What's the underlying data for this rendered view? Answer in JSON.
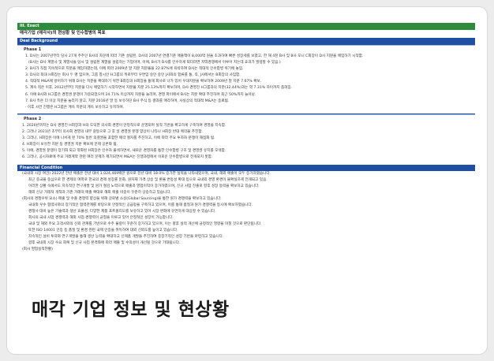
{
  "document": {
    "top_label": "III. Exect",
    "report_title": "매각기업 (매각사)의 현상황 및 인수합병의 목표",
    "deal_background_label": "Deal Background",
    "phase1": {
      "label": "Phase 1",
      "lines": [
        "1. D사는 2007년부터 당사 27개 주주인 B사의 자문에 따라 기존 설립된, D사의 2007년 연결기준 매출액이 8,000억 원을 초과하여 빠른 성장세를 보였고, 한 해 4천 B사 및 B사 모니 C회장이 D사 지분을 매입하기 시작함.",
        "(B사는 D사 계열사 및 계열사들 당사 및 설립된 계열을 설립하는 기업이며, 이에, B사가 D사를 인수하게 되더라면 지역경쟁에서 이루어 지는데 효과가 발생할 수 있음.)",
        "2. B사가 직접 지속적으로 지분을 매입하였는데, 이에 따라 2009년 말 지분 지분율을 22.87%에 육박하여 D사는 적대적 인수합병 위기에 놓임.",
        "3. D사의 최대 H회장는 회사 두 명 임으며, 그룹 창시인 H그룹의 뒤로부터 우면임 승인 중인 J사와의 합류를 통, 즉, J사에서는 B회장의 사임함.",
        "4. 적대적 M&A에 방어하기 위해 D사는 지분을 확대하기 위한 B회장과 H회장을 통해 회사로 나가 있어 우대지분을 확보하여 2009년 말 지분 7.67% 확보.",
        "5. 계속 적은 이후, 2012년부터 지분을 다시 매입하기 시작하면서 지분율 지분 25.13%까지 확보하며, D사 경영진 H그룹과의 지분(32.44%)과는 약 7.31% 차이까지 좁혀짐.",
        "6. 이에 B사와 H그룹은 경영권 분쟁이 가중되었으며 24.71% 이상까지 지분을 늘리며, 경영 파이에서 B사는 지분 확대 추진하며 최근 50%까지 늘어남.",
        "7. B사 측은 더 이상 지분을 늘리지 않고, 지분 2016년 말 등 보유하던 B사 주식 등 결과를 매각하며, 사실상의 적대적 M&A는 종료됨.",
        "· 이후 사건 진행은 H그룹은 계속 지분의 계속 보유하고 유지하며."
      ]
    },
    "phase2": {
      "label": "Phase 2",
      "lines": [
        "1. 2020년까지는 D사 경영진 H회장과 H의 도덕한 의사회 경영이 안정적으로 운영되며 실적 기반을 확고하게 구축하여 경영을 지속함.",
        "2. 그러나 2021년 초부터 의사회 경영의 내부 갈등으로 그 후 일 경영권 분쟁 양상이 나타나 H회장 반대 매각을 추진함.",
        "3. 그러나, H회장은 이에 나서게 된 70% 동반 의결권을 포함한 매각 절차를 추진하고, 이에 따라 주요 투자자 분쟁이 재점화 됨.",
        "4. H회장이 보유한 지분 등 경영권 지분 확보에 문제 공론화 됨.",
        "5. 이에, 경영권 분쟁이 장기화 되고 약화된 H회장은 인수자 물색하면서, 새로운 경영자를 통한 인수합병 구조 및 경영권 유지를 모색함.",
        "6. 그러나, 공시자료에 주요 거래계약 관련 여러 문제가 제기되면서 M&A는 진행과정에서 이로운 인수합병으로 전개되지 못함."
      ]
    },
    "financial": {
      "label": "Financial Condition",
      "lines": [
        "(국내외 시장 여건) 2022년 전년 매출은 전년 대비 1,024,469백만 원으로 전년 대비 18.0% 증가한 실적을 나타내었으며, 국내, 해외 매출이 모두 증가하였습니다.",
        "최근 중국을 중심으로 한 경제의 여파로 한국의 경제 성장률 둔화, 원자재 가격 상승 및 환율 변동성 확대 등으로 국내외 경영 환경이 불확실하게 전개되고 있음.",
        "이러한 상황 속에서도 지속적인 연구개발 및 원가 절감 노력으로 매출과 영업이익이 증가하였으며, 신규 사업 진출로 향후 성장 동력을 확보하고 있습니다.",
        "해외 신규 거래처 개척과 기존 거래처 매출 확대로 해외 매출 비중이 꾸준히 상승하고 있습니다.",
        "(회사의 경쟁우위 요소) 매출 및 수출 경쟁력 향상을 위해 글로벌 소싱(Global Sourcing)을 통한 원가 경쟁력을 확보하고 있습니다.",
        "국내외 우수 협력사와의 장기적인 협력관계를 바탕으로 안정적인 공급망을 구축하고 있으며, 이를 통해 품질과 원가 경쟁력을 동시에 확보하였습니다.",
        "경쟁사 대비 높은 기술력과 생산 효율성, 다양한 제품 포트폴리오를 보유하고 있어 시장 변화에 유연하게 대응할 수 있습니다.",
        "회사의 국내 사업 경쟁력과 해외 사업 경쟁력이 균형을 이루고 있어 안정적인 성장이 가능합니다.",
        "국내 및 해외 주요 고객사와의 신뢰 관계를 기반으로 수주 물량이 꾸준히 증가하고 있으며, 이는 향후 실적 개선에 긍정적인 영향을 미칠 것으로 판단됩니다.",
        "또한 ISO 14001 인증 등 품질 및 환경 관련 국제 인증을 취득하여 대외 신뢰도를 높이고 있습니다.",
        "지속적인 설비 투자와 연구개발을 통해 생산 능력을 확대하고 신제품 개발을 추진하여 중장기적인 성장 기반을 마련하고 있습니다.",
        "향후 국내외 시장 수요 회복 및 신규 사업 본격화에 따라 매출 및 수익성이 개선될 것으로 기대됩니다.",
        "(회사 영업실적현황)"
      ]
    }
  },
  "caption": "매각 기업 정보 및 현상황"
}
